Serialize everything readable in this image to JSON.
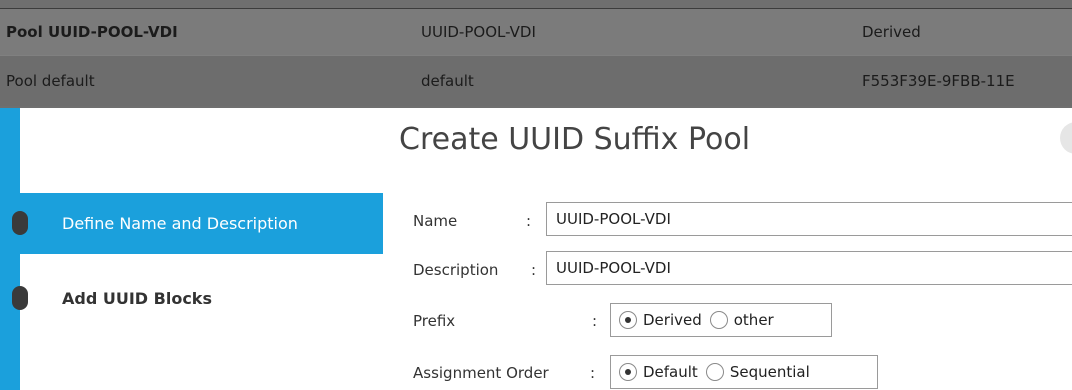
{
  "background_table": {
    "rows": [
      {
        "name": "Pool UUID-POOL-VDI",
        "value": "UUID-POOL-VDI",
        "prefix": "Derived"
      },
      {
        "name": "Pool default",
        "value": "default",
        "prefix": "F553F39E-9FBB-11E"
      }
    ]
  },
  "wizard": {
    "steps": [
      {
        "label": "Define Name and Description",
        "active": true
      },
      {
        "label": "Add UUID Blocks",
        "active": false
      }
    ],
    "title": "Create UUID Suffix Pool",
    "form": {
      "name_label": "Name",
      "name_value": "UUID-POOL-VDI",
      "description_label": "Description",
      "description_value": "UUID-POOL-VDI",
      "prefix_label": "Prefix",
      "prefix_options": [
        "Derived",
        "other"
      ],
      "prefix_selected": "Derived",
      "assignment_label": "Assignment Order",
      "assignment_options": [
        "Default",
        "Sequential"
      ],
      "assignment_selected": "Default",
      "colon": ":"
    }
  },
  "colors": {
    "accent": "#1ba0dc",
    "overlay_gray": "#6f6f6f"
  }
}
